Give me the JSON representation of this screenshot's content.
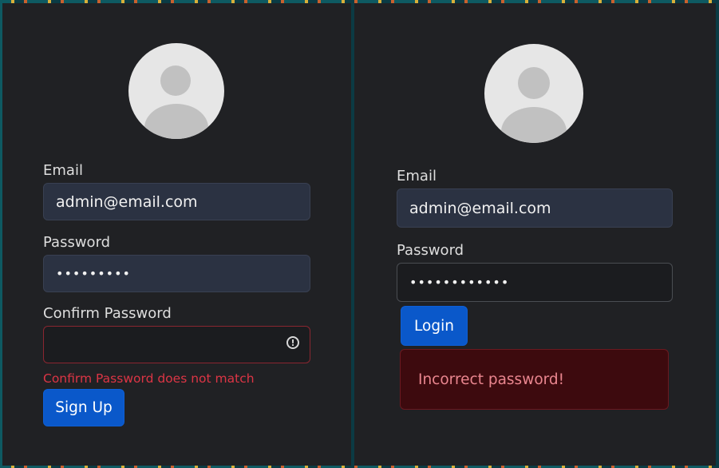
{
  "signup": {
    "email_label": "Email",
    "email_value": "admin@email.com",
    "password_label": "Password",
    "password_value": "•••••••••",
    "confirm_label": "Confirm Password",
    "confirm_value": "",
    "confirm_error": "Confirm Password does not match",
    "submit_label": "Sign Up"
  },
  "login": {
    "email_label": "Email",
    "email_value": "admin@email.com",
    "password_label": "Password",
    "password_value": "••••••••••••",
    "submit_label": "Login",
    "alert_text": "Incorrect password!"
  },
  "icons": {
    "avatar": "user-avatar-icon",
    "error": "exclamation-circle-icon"
  },
  "colors": {
    "panel_bg": "#202124",
    "primary": "#0a58ca",
    "danger": "#dc3545",
    "alert_bg": "#3d0a0e"
  }
}
